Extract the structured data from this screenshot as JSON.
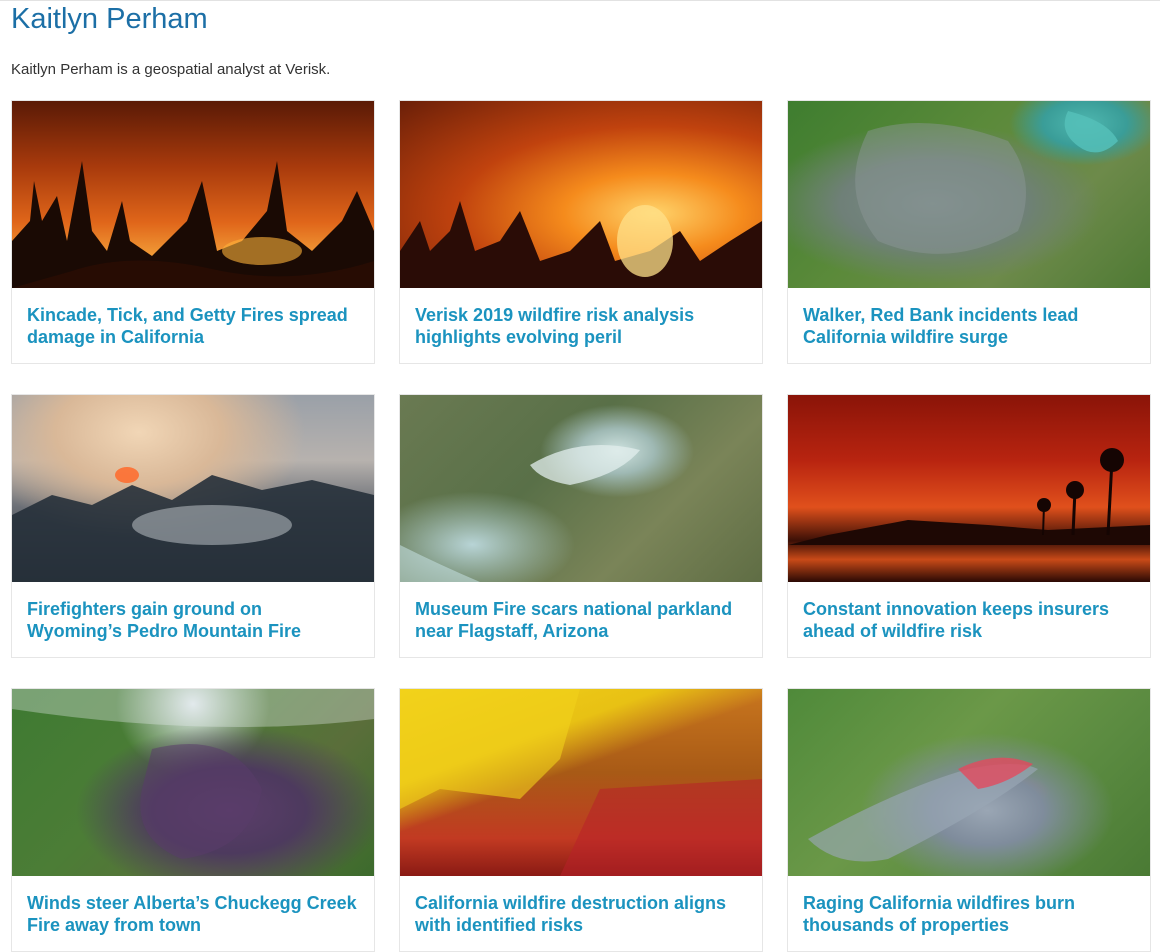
{
  "author": {
    "name": "Kaitlyn Perham",
    "bio": "Kaitlyn Perham is a geospatial analyst at Verisk."
  },
  "colors": {
    "heading": "#1c6fa6",
    "link": "#1b93bf",
    "text": "#333333"
  },
  "articles": [
    {
      "title": "Kincade, Tick, and Getty Fires spread damage in California",
      "image": "forest-fire-photo"
    },
    {
      "title": "Verisk 2019 wildfire risk analysis highlights evolving peril",
      "image": "forest-fire-photo"
    },
    {
      "title": "Walker, Red Bank incidents lead California wildfire surge",
      "image": "satellite-image"
    },
    {
      "title": "Firefighters gain ground on Wyoming’s Pedro Mountain Fire",
      "image": "smoke-photo"
    },
    {
      "title": "Museum Fire scars national parkland near Flagstaff, Arizona",
      "image": "satellite-image"
    },
    {
      "title": "Constant innovation keeps insurers ahead of wildfire risk",
      "image": "beach-fire-photo"
    },
    {
      "title": "Winds steer Alberta’s Chuckegg Creek Fire away from town",
      "image": "satellite-image"
    },
    {
      "title": "California wildfire destruction aligns with identified risks",
      "image": "risk-map-image"
    },
    {
      "title": "Raging California wildfires burn thousands of properties",
      "image": "satellite-image"
    }
  ]
}
